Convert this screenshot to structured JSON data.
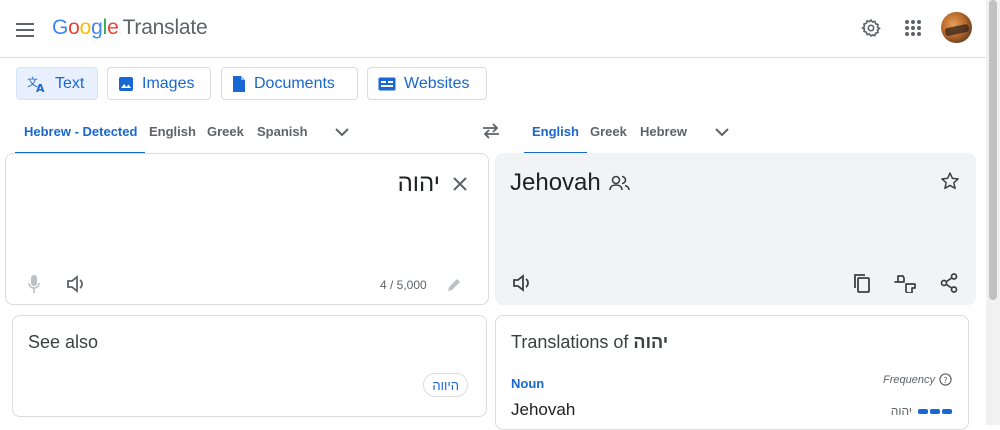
{
  "header": {
    "logo_google": [
      "G",
      "o",
      "o",
      "g",
      "l",
      "e"
    ],
    "logo_product": "Translate"
  },
  "modes": {
    "text": "Text",
    "images": "Images",
    "documents": "Documents",
    "websites": "Websites"
  },
  "source_languages": [
    "Hebrew - Detected",
    "English",
    "Greek",
    "Spanish"
  ],
  "target_languages": [
    "English",
    "Greek",
    "Hebrew"
  ],
  "source": {
    "text": "יהוה",
    "char_count": "4 / 5,000"
  },
  "target": {
    "text": "Jehovah"
  },
  "see_also": {
    "title": "See also",
    "chips": [
      "היווה"
    ]
  },
  "translations": {
    "title_prefix": "Translations of",
    "title_word": "יהוה",
    "part_of_speech": "Noun",
    "frequency_label": "Frequency",
    "entries": [
      {
        "word": "Jehovah",
        "back": "יהוה",
        "frequency": 3
      }
    ]
  },
  "colors": {
    "accent": "#1967d2",
    "chip_active_bg": "#e8f0fe",
    "target_panel_bg": "#f1f3f4"
  }
}
